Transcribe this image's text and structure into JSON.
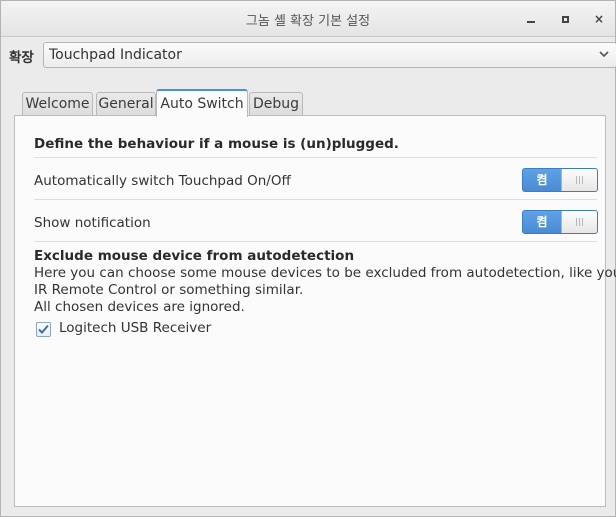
{
  "window": {
    "title": "그놈 셸 확장 기본 설정",
    "minimize_label": "–",
    "close_label": "×"
  },
  "extension": {
    "label": "확장",
    "selected": "Touchpad Indicator"
  },
  "tabs": [
    {
      "label": "Welcome",
      "active": false
    },
    {
      "label": "General",
      "active": false
    },
    {
      "label": "Auto Switch",
      "active": true
    },
    {
      "label": "Debug",
      "active": false
    }
  ],
  "panel": {
    "heading": "Define the behaviour if a mouse is (un)plugged.",
    "auto_switch": {
      "label": "Automatically switch Touchpad On/Off",
      "state_label": "켬",
      "on": true
    },
    "notification": {
      "label": "Show notification",
      "state_label": "켬",
      "on": true
    },
    "exclude": {
      "heading": "Exclude mouse device from autodetection",
      "line1": "Here you can choose some mouse devices to be excluded from autodetection, like your",
      "line2": "IR Remote Control or something similar.",
      "line3": "All chosen devices are ignored."
    },
    "devices": [
      {
        "label": "Logitech USB Receiver",
        "checked": true
      }
    ]
  },
  "colors": {
    "accent": "#4a90d9",
    "switch_on": "#4a8bd4"
  }
}
